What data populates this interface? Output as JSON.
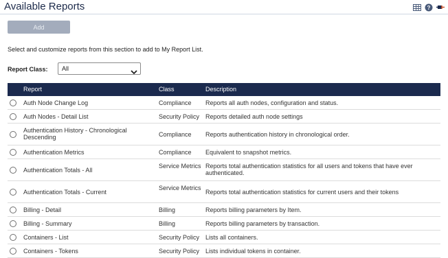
{
  "page": {
    "title": "Available Reports",
    "add_label": "Add",
    "instructions": "Select and customize reports from this section to add to My Report List.",
    "filter_label": "Report Class:",
    "filter_value": "All"
  },
  "icons": [
    "grid-view-icon",
    "help-icon",
    "pin-icon"
  ],
  "colors": {
    "header_bg": "#1b2a4e",
    "disabled_button": "#a3acbc"
  },
  "table": {
    "columns": [
      "Report",
      "Class",
      "Description"
    ],
    "rows": [
      {
        "report": "Auth Node Change Log",
        "class": "Compliance",
        "description": "Reports all auth nodes, configuration and status."
      },
      {
        "report": "Auth Nodes - Detail List",
        "class": "Security Policy",
        "description": "Reports detailed auth node settings"
      },
      {
        "report": "Authentication History - Chronological Descending",
        "class": "Compliance",
        "description": "Reports authentication history in chronological order."
      },
      {
        "report": "Authentication Metrics",
        "class": "Compliance",
        "description": "Equivalent to snapshot metrics."
      },
      {
        "report": "Authentication Totals - All",
        "class": "Service Metrics",
        "description": "Reports total authentication statistics for all users and tokens that have ever authenticated."
      },
      {
        "report": "Authentication Totals - Current",
        "class": "Service Metrics",
        "description": "Reports total authentication statistics for current users and their tokens"
      },
      {
        "report": "Billing - Detail",
        "class": "Billing",
        "description": "Reports billing parameters by Item."
      },
      {
        "report": "Billing - Summary",
        "class": "Billing",
        "description": "Reports billing parameters by transaction."
      },
      {
        "report": "Containers - List",
        "class": "Security Policy",
        "description": "Lists all containers."
      },
      {
        "report": "Containers - Tokens",
        "class": "Security Policy",
        "description": "Lists individual tokens in container."
      }
    ]
  }
}
